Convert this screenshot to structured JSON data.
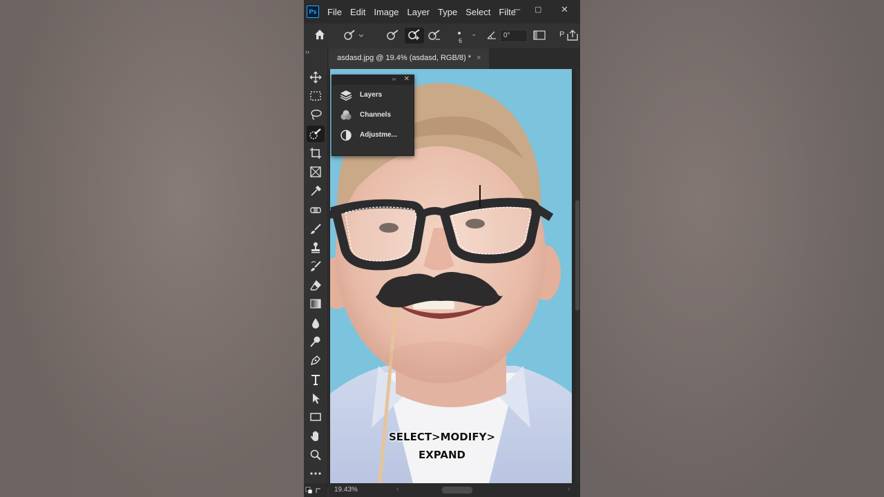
{
  "app": {
    "logo_text": "Ps",
    "menu": [
      "File",
      "Edit",
      "Image",
      "Layer",
      "Type",
      "Select",
      "Filte"
    ],
    "window_controls": {
      "minimize": "─",
      "restore": "▢",
      "close": "✕"
    }
  },
  "options_bar": {
    "brush_size": "6",
    "angle": "0°",
    "trailing_letter": "P"
  },
  "document": {
    "tab_title": "asdasd.jpg @ 19.4% (asdasd, RGB/8) *",
    "tab_close": "×",
    "zoom_status": "19.43%"
  },
  "panel": {
    "items": [
      {
        "label": "Layers",
        "icon": "layers-icon"
      },
      {
        "label": "Channels",
        "icon": "channels-icon"
      },
      {
        "label": "Adjustme...",
        "icon": "adjustments-icon"
      }
    ]
  },
  "caption": {
    "line1": "SELECT>MODIFY>",
    "line2": "EXPAND"
  },
  "colors": {
    "accent": "#31a8ff",
    "photo_background": "#7cc3dd",
    "ui_dark": "#323232"
  }
}
